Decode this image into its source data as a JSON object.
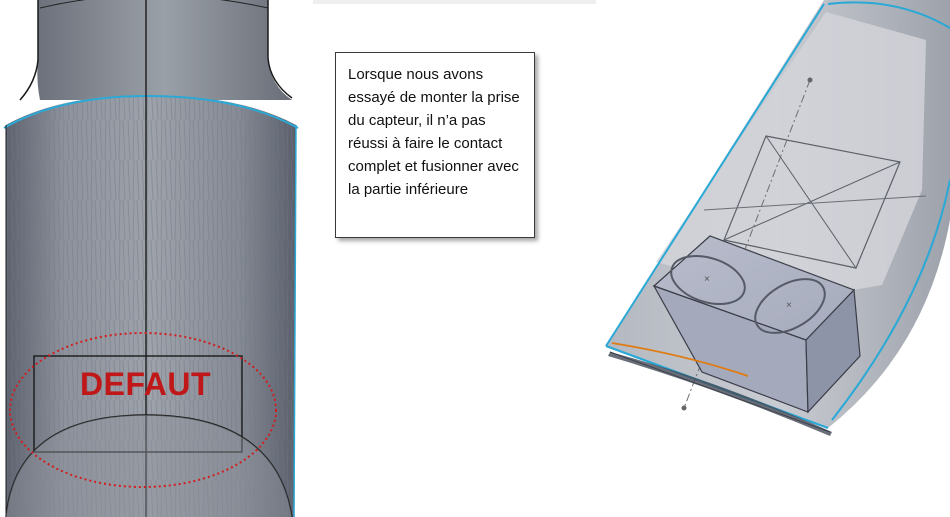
{
  "callout": {
    "text": "Lorsque nous avons essayé de monter la prise du capteur, il n’a pas réussi à faire le contact complet et fusionner avec la partie inférieure"
  },
  "defect_label": "DEFAUT",
  "colors": {
    "model_gray": "#8a8f99",
    "model_edge": "#1a1a1a",
    "highlight_blue": "#2aa9d6",
    "defect_red": "#c01818",
    "sensor_block": "#9da3b4",
    "orange_line": "#e07b10"
  }
}
